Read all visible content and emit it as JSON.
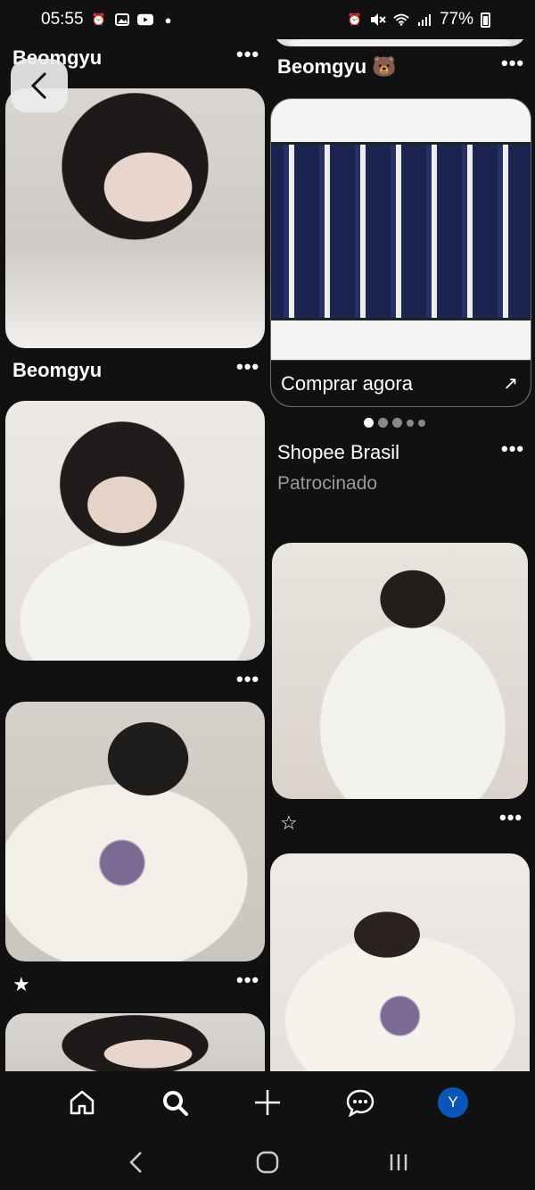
{
  "status_bar": {
    "time": "05:55",
    "battery": "77%",
    "left_icons": [
      "alarm-icon",
      "gallery-icon",
      "youtube-icon",
      "dot-icon"
    ],
    "right_icons": [
      "alarm-icon",
      "mute-icon",
      "wifi-icon",
      "signal-icon",
      "battery-icon"
    ]
  },
  "feed": {
    "left_column": {
      "pin1": {
        "title": "Beomgyu",
        "more": "•••"
      },
      "pin2": {
        "title": "Beomgyu",
        "more": "•••"
      },
      "pin3": {
        "more": "•••"
      },
      "pin4": {
        "star": "★",
        "more": "•••"
      }
    },
    "right_column": {
      "pin_top": {
        "title": "Beomgyu 🐻",
        "more": "•••"
      },
      "ad": {
        "cta": "Comprar agora",
        "cta_icon": "↗",
        "advertiser": "Shopee Brasil",
        "sponsored": "Patrocinado",
        "more": "•••",
        "carousel_dots": 5,
        "carousel_active": 0
      },
      "pin_rooftop": {
        "star": "☆",
        "more": "•••"
      }
    }
  },
  "back_button": {
    "icon": "back-arrow-icon"
  },
  "bottom_nav": {
    "items": [
      "home-icon",
      "search-icon",
      "add-icon",
      "messages-icon",
      "profile-avatar"
    ],
    "avatar_letter": "Y",
    "avatar_color": "#0a56b8"
  },
  "system_nav": [
    "back-icon",
    "home-icon",
    "recents-icon"
  ]
}
